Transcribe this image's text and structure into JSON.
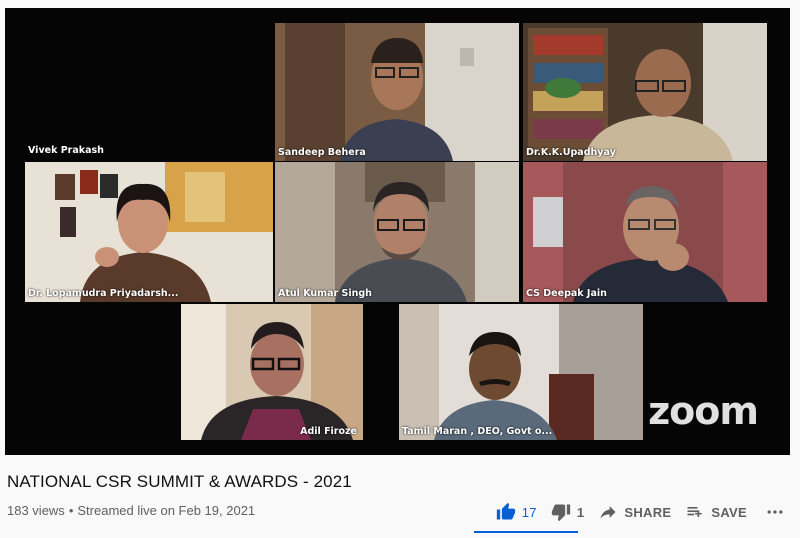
{
  "video": {
    "participants": [
      {
        "name": "Vivek Prakash"
      },
      {
        "name": "Sandeep Behera"
      },
      {
        "name": "Dr.K.K.Upadhyay"
      },
      {
        "name": "Dr. Lopamudra Priyadarsh..."
      },
      {
        "name": "Atul Kumar Singh"
      },
      {
        "name": "CS Deepak Jain"
      },
      {
        "name": "Adil Firoze"
      },
      {
        "name": "Tamil Maran , DEO, Govt o..."
      }
    ],
    "watermark": "zoom",
    "active_speaker_color": "#7bd148"
  },
  "info": {
    "title": "NATIONAL CSR SUMMIT & AWARDS - 2021",
    "views": "183 views",
    "streamed": "Streamed live on Feb 19, 2021"
  },
  "actions": {
    "like_count": "17",
    "dislike_count": "1",
    "share_label": "SHARE",
    "save_label": "SAVE",
    "like_icon": "thumb-up-icon",
    "dislike_icon": "thumb-down-icon",
    "share_icon": "share-arrow-icon",
    "save_icon": "playlist-add-icon",
    "more_icon": "more-horizontal-icon",
    "accent_color": "#065fd4"
  }
}
